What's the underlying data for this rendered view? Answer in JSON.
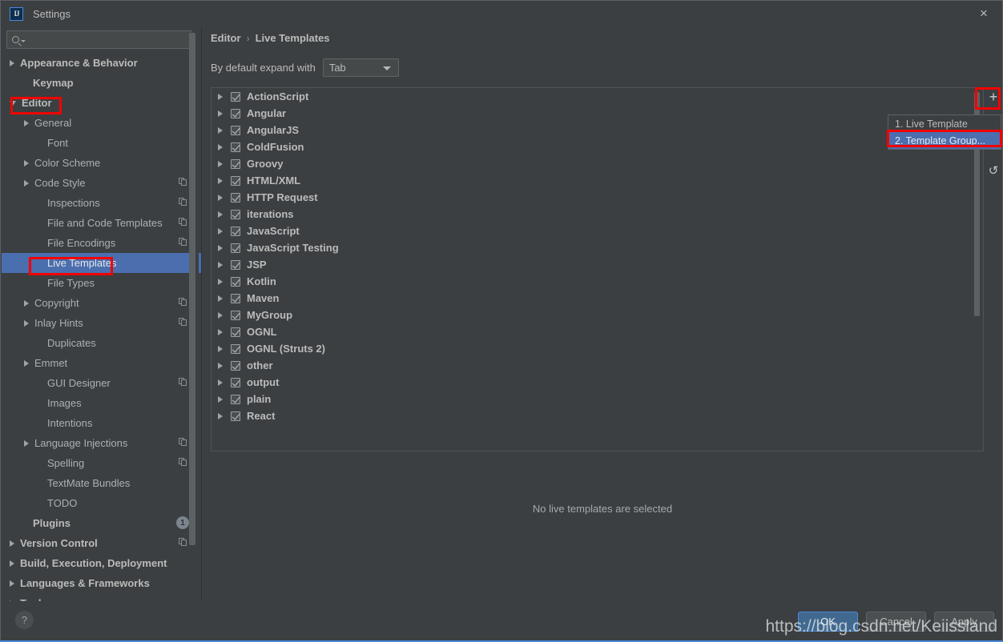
{
  "window": {
    "title": "Settings",
    "logo_text": "IJ",
    "close_icon": "×"
  },
  "search": {
    "value": "",
    "placeholder": ""
  },
  "sidebar": {
    "items": [
      {
        "label": "Appearance & Behavior",
        "arrow": "right",
        "indent": 10,
        "bold": true,
        "copy": false,
        "selected": false
      },
      {
        "label": "Keymap",
        "arrow": "none",
        "indent": 26,
        "bold": true,
        "copy": false,
        "selected": false
      },
      {
        "label": "Editor",
        "arrow": "down",
        "indent": 10,
        "bold": true,
        "copy": false,
        "selected": false
      },
      {
        "label": "General",
        "arrow": "right",
        "indent": 28,
        "bold": false,
        "copy": false,
        "selected": false
      },
      {
        "label": "Font",
        "arrow": "none",
        "indent": 44,
        "bold": false,
        "copy": false,
        "selected": false
      },
      {
        "label": "Color Scheme",
        "arrow": "right",
        "indent": 28,
        "bold": false,
        "copy": false,
        "selected": false
      },
      {
        "label": "Code Style",
        "arrow": "right",
        "indent": 28,
        "bold": false,
        "copy": true,
        "selected": false
      },
      {
        "label": "Inspections",
        "arrow": "none",
        "indent": 44,
        "bold": false,
        "copy": true,
        "selected": false
      },
      {
        "label": "File and Code Templates",
        "arrow": "none",
        "indent": 44,
        "bold": false,
        "copy": true,
        "selected": false
      },
      {
        "label": "File Encodings",
        "arrow": "none",
        "indent": 44,
        "bold": false,
        "copy": true,
        "selected": false
      },
      {
        "label": "Live Templates",
        "arrow": "none",
        "indent": 44,
        "bold": false,
        "copy": false,
        "selected": true
      },
      {
        "label": "File Types",
        "arrow": "none",
        "indent": 44,
        "bold": false,
        "copy": false,
        "selected": false
      },
      {
        "label": "Copyright",
        "arrow": "right",
        "indent": 28,
        "bold": false,
        "copy": true,
        "selected": false
      },
      {
        "label": "Inlay Hints",
        "arrow": "right",
        "indent": 28,
        "bold": false,
        "copy": true,
        "selected": false
      },
      {
        "label": "Duplicates",
        "arrow": "none",
        "indent": 44,
        "bold": false,
        "copy": false,
        "selected": false
      },
      {
        "label": "Emmet",
        "arrow": "right",
        "indent": 28,
        "bold": false,
        "copy": false,
        "selected": false
      },
      {
        "label": "GUI Designer",
        "arrow": "none",
        "indent": 44,
        "bold": false,
        "copy": true,
        "selected": false
      },
      {
        "label": "Images",
        "arrow": "none",
        "indent": 44,
        "bold": false,
        "copy": false,
        "selected": false
      },
      {
        "label": "Intentions",
        "arrow": "none",
        "indent": 44,
        "bold": false,
        "copy": false,
        "selected": false
      },
      {
        "label": "Language Injections",
        "arrow": "right",
        "indent": 28,
        "bold": false,
        "copy": true,
        "selected": false
      },
      {
        "label": "Spelling",
        "arrow": "none",
        "indent": 44,
        "bold": false,
        "copy": true,
        "selected": false
      },
      {
        "label": "TextMate Bundles",
        "arrow": "none",
        "indent": 44,
        "bold": false,
        "copy": false,
        "selected": false
      },
      {
        "label": "TODO",
        "arrow": "none",
        "indent": 44,
        "bold": false,
        "copy": false,
        "selected": false
      },
      {
        "label": "Plugins",
        "arrow": "none",
        "indent": 26,
        "bold": true,
        "copy": false,
        "selected": false,
        "badge": "1"
      },
      {
        "label": "Version Control",
        "arrow": "right",
        "indent": 10,
        "bold": true,
        "copy": true,
        "selected": false
      },
      {
        "label": "Build, Execution, Deployment",
        "arrow": "right",
        "indent": 10,
        "bold": true,
        "copy": false,
        "selected": false
      },
      {
        "label": "Languages & Frameworks",
        "arrow": "right",
        "indent": 10,
        "bold": true,
        "copy": false,
        "selected": false
      },
      {
        "label": "Tools",
        "arrow": "right",
        "indent": 10,
        "bold": true,
        "copy": false,
        "selected": false
      }
    ]
  },
  "main": {
    "breadcrumb": {
      "parent": "Editor",
      "separator": "›",
      "current": "Live Templates"
    },
    "expand_with": {
      "label": "By default expand with",
      "value": "Tab"
    },
    "empty_message": "No live templates are selected",
    "template_groups": [
      {
        "label": "ActionScript",
        "checked": true
      },
      {
        "label": "Angular",
        "checked": true
      },
      {
        "label": "AngularJS",
        "checked": true
      },
      {
        "label": "ColdFusion",
        "checked": true
      },
      {
        "label": "Groovy",
        "checked": true
      },
      {
        "label": "HTML/XML",
        "checked": true
      },
      {
        "label": "HTTP Request",
        "checked": true
      },
      {
        "label": "iterations",
        "checked": true
      },
      {
        "label": "JavaScript",
        "checked": true
      },
      {
        "label": "JavaScript Testing",
        "checked": true
      },
      {
        "label": "JSP",
        "checked": true
      },
      {
        "label": "Kotlin",
        "checked": true
      },
      {
        "label": "Maven",
        "checked": true
      },
      {
        "label": "MyGroup",
        "checked": true
      },
      {
        "label": "OGNL",
        "checked": true
      },
      {
        "label": "OGNL (Struts 2)",
        "checked": true
      },
      {
        "label": "other",
        "checked": true
      },
      {
        "label": "output",
        "checked": true
      },
      {
        "label": "plain",
        "checked": true
      },
      {
        "label": "React",
        "checked": true
      }
    ],
    "toolbar": {
      "add_icon": "+",
      "revert_icon": "↺"
    },
    "popup_menu": {
      "items": [
        {
          "label": "1. Live Template",
          "highlighted": false
        },
        {
          "label": "2. Template Group...",
          "highlighted": true
        }
      ]
    }
  },
  "footer": {
    "help_icon": "?",
    "ok_label": "OK",
    "cancel_label": "Cancel",
    "apply_label": "Apply"
  },
  "watermark": "https://blog.csdn.net/Keiissland",
  "colors": {
    "background": "#3c3f41",
    "selection_blue": "#4b6eaf",
    "annotation_red": "#f40000",
    "primary_button": "#41698f",
    "text": "#bbbbbb"
  }
}
